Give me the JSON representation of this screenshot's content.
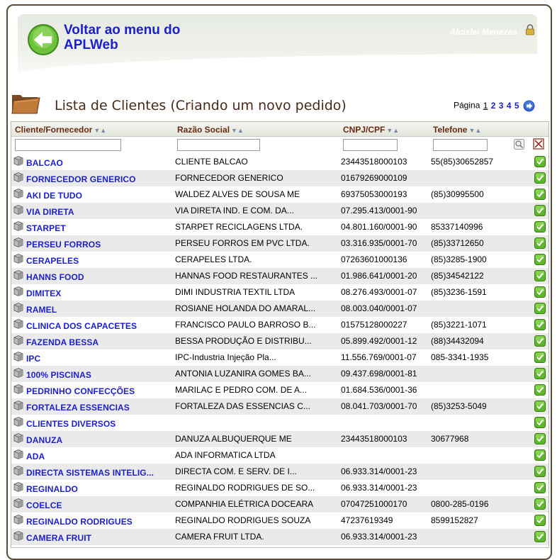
{
  "header": {
    "back_label": "Voltar ao menu do APLWeb",
    "user_name": "Alcislei Menezes"
  },
  "page": {
    "title": "Lista de Clientes (Criando um novo pedido)"
  },
  "pager": {
    "label": "Página",
    "pages": [
      "1",
      "2",
      "3",
      "4",
      "5"
    ],
    "current": "1"
  },
  "grid": {
    "columns": [
      "Cliente/Fornecedor",
      "Razão Social",
      "CNPJ/CPF",
      "Telefone"
    ],
    "rows": [
      {
        "cliente": "BALCAO",
        "razao": "CLIENTE BALCAO",
        "cnpj": "23443518000103",
        "telefone": "55(85)30652857"
      },
      {
        "cliente": "FORNECEDOR GENERICO",
        "razao": "FORNECEDOR GENERICO",
        "cnpj": "01679269000109",
        "telefone": ""
      },
      {
        "cliente": "AKI DE TUDO",
        "razao": "WALDEZ ALVES DE SOUSA ME",
        "cnpj": "69375053000193",
        "telefone": "(85)30995500"
      },
      {
        "cliente": "VIA DIRETA",
        "razao": "VIA DIRETA IND. E COM. DA...",
        "cnpj": "07.295.413/0001-90",
        "telefone": ""
      },
      {
        "cliente": "STARPET",
        "razao": "STARPET RECICLAGENS LTDA.",
        "cnpj": "04.801.160/0001-90",
        "telefone": "85337140996"
      },
      {
        "cliente": "PERSEU FORROS",
        "razao": "PERSEU FORROS EM PVC LTDA.",
        "cnpj": "03.316.935/0001-70",
        "telefone": "(85)33712650"
      },
      {
        "cliente": "CERAPELES",
        "razao": "CERAPELES LTDA.",
        "cnpj": "07263601000136",
        "telefone": "(85)3285-1900"
      },
      {
        "cliente": "HANNS FOOD",
        "razao": "HANNAS FOOD RESTAURANTES ...",
        "cnpj": "01.986.641/0001-20",
        "telefone": "(85)34542122"
      },
      {
        "cliente": "DIMITEX",
        "razao": "DIMI INDUSTRIA TEXTIL LTDA",
        "cnpj": "08.276.493/0001-07",
        "telefone": "(85)3236-1591"
      },
      {
        "cliente": "RAMEL",
        "razao": "ROSIANE HOLANDA DO AMARAL...",
        "cnpj": "08.003.040/0001-07",
        "telefone": ""
      },
      {
        "cliente": "CLINICA DOS CAPACETES",
        "razao": "FRANCISCO PAULO BARROSO B...",
        "cnpj": "01575128000227",
        "telefone": "(85)3221-1071"
      },
      {
        "cliente": "FAZENDA BESSA",
        "razao": "BESSA PRODUÇÃO E DISTRIBU...",
        "cnpj": "05.899.492/0001-12",
        "telefone": "(88)34432094"
      },
      {
        "cliente": "IPC",
        "razao": "IPC-Industria Injeção Pla...",
        "cnpj": "11.556.769/0001-07",
        "telefone": "085-3341-1935"
      },
      {
        "cliente": "100% PISCINAS",
        "razao": "ANTONIA LUZANIRA GOMES BA...",
        "cnpj": "09.437.698/0001-81",
        "telefone": ""
      },
      {
        "cliente": "PEDRINHO CONFECÇÕES",
        "razao": "MARILAC E PEDRO COM. DE A...",
        "cnpj": "01.684.536/0001-36",
        "telefone": ""
      },
      {
        "cliente": "FORTALEZA ESSENCIAS",
        "razao": "FORTALEZA DAS ESSENCIAS C...",
        "cnpj": "08.041.703/0001-70",
        "telefone": "(85)3253-5049"
      },
      {
        "cliente": "CLIENTES DIVERSOS",
        "razao": "",
        "cnpj": "",
        "telefone": ""
      },
      {
        "cliente": "DANUZA",
        "razao": "DANUZA ALBUQUERQUE ME",
        "cnpj": "23443518000103",
        "telefone": "30677968"
      },
      {
        "cliente": "ADA",
        "razao": "ADA INFORMATICA LTDA",
        "cnpj": "",
        "telefone": ""
      },
      {
        "cliente": "DIRECTA SISTEMAS INTELIG...",
        "razao": "DIRECTA COM. E SERV. DE I...",
        "cnpj": "06.933.314/0001-23",
        "telefone": ""
      },
      {
        "cliente": "REGINALDO",
        "razao": "REGINALDO RODRIGUES DE SO...",
        "cnpj": "06.933.314/0001-23",
        "telefone": ""
      },
      {
        "cliente": "COELCE",
        "razao": "COMPANHIA ELÉTRICA DOCEARA",
        "cnpj": "07047251000170",
        "telefone": "0800-285-0196"
      },
      {
        "cliente": "REGINALDO RODRIGUES",
        "razao": "REGINALDO RODRIGUES SOUZA",
        "cnpj": "47237619349",
        "telefone": "8599152827"
      },
      {
        "cliente": "CAMERA FRUIT",
        "razao": "CAMERA FRUIT LTDA.",
        "cnpj": "06.933.314/0001-23",
        "telefone": ""
      }
    ]
  },
  "colors": {
    "link_blue": "#1a1fcf",
    "title_brown": "#4a2a1a",
    "header_text": "#6b2a10",
    "row_alt": "#eaeaea",
    "ok_green": "#5cb82a"
  },
  "icons": {
    "back": "back-arrow-icon",
    "lock": "lock-icon",
    "folder": "folder-icon",
    "next": "next-page-icon",
    "search": "search-icon",
    "clear": "clear-filter-icon",
    "row": "cube-icon",
    "select": "check-icon"
  }
}
